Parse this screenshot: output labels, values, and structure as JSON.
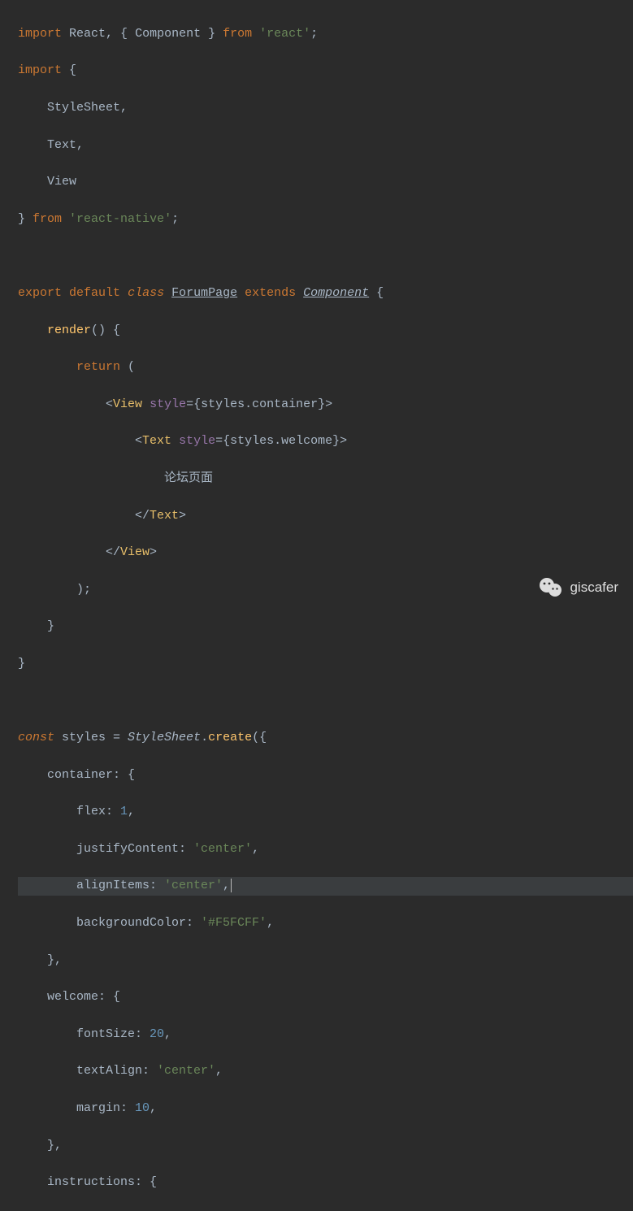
{
  "code": {
    "l1": {
      "kw_import": "import",
      "React": "React",
      "comma": ", { ",
      "Component": "Component",
      "close": " } ",
      "kw_from": "from",
      "str_react": "'react'",
      "semi": ";"
    },
    "l2": {
      "kw_import": "import",
      "brace": " {"
    },
    "l3": {
      "t": "    StyleSheet,"
    },
    "l4": {
      "t": "    Text,"
    },
    "l5": {
      "t": "    View"
    },
    "l6": {
      "brace": "} ",
      "kw_from": "from",
      "str_rn": "'react-native'",
      "semi": ";"
    },
    "l7": "",
    "l8": {
      "kw_export": "export",
      "kw_default": "default",
      "kw_class": "class",
      "ForumPage": "ForumPage",
      "kw_extends": "extends",
      "Component": "Component",
      "brace": " {"
    },
    "l9": {
      "pad": "    ",
      "render": "render",
      "paren": "() {"
    },
    "l10": {
      "pad": "        ",
      "kw_return": "return",
      "paren": " ("
    },
    "l11": {
      "pad": "            <",
      "tag": "View",
      "sp": " ",
      "attr": "style",
      "eq": "=",
      "val": "{styles.container}>",
      "close": ""
    },
    "l12": {
      "pad": "                <",
      "tag": "Text",
      "sp": " ",
      "attr": "style",
      "eq": "=",
      "val": "{styles.welcome}>"
    },
    "l13": {
      "pad": "                    ",
      "text": "论坛页面"
    },
    "l14": {
      "pad": "                </",
      "tag": "Text",
      "gt": ">"
    },
    "l15": {
      "pad": "            </",
      "tag": "View",
      "gt": ">"
    },
    "l16": {
      "pad": "        );",
      "t": ""
    },
    "l17": {
      "t": "    }"
    },
    "l18": {
      "t": "}"
    },
    "l19": "",
    "l20": {
      "kw_const": "const",
      "styles": " styles ",
      "eq": "= ",
      "StyleSheet": "StyleSheet",
      "dot": ".",
      "create": "create",
      "paren": "({"
    },
    "l21": {
      "t": "    container: {"
    },
    "l22": {
      "pad": "        flex: ",
      "num": "1",
      "comma": ","
    },
    "l23": {
      "pad": "        justifyContent: ",
      "str": "'center'",
      "comma": ","
    },
    "l24": {
      "pad": "        alignItems: ",
      "str": "'center'",
      "comma": ","
    },
    "l25": {
      "pad": "        backgroundColor: ",
      "str": "'#F5FCFF'",
      "comma": ","
    },
    "l26": {
      "t": "    },"
    },
    "l27": {
      "t": "    welcome: {"
    },
    "l28": {
      "pad": "        fontSize: ",
      "num": "20",
      "comma": ","
    },
    "l29": {
      "pad": "        textAlign: ",
      "str": "'center'",
      "comma": ","
    },
    "l30": {
      "pad": "        margin: ",
      "num": "10",
      "comma": ","
    },
    "l31": {
      "t": "    },"
    },
    "l32": {
      "t": "    instructions: {"
    }
  },
  "watermark": {
    "label": "giscafer"
  }
}
